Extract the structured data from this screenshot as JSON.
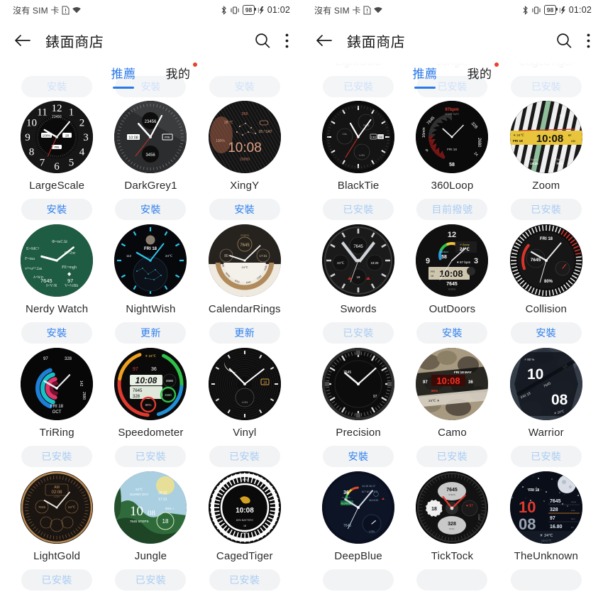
{
  "statusbar": {
    "carrier": "沒有 SIM 卡",
    "sim_icon": "sim-missing-icon",
    "wifi_icon": "wifi-icon",
    "bluetooth_icon": "bluetooth-icon",
    "vibrate_icon": "vibrate-icon",
    "battery_level": "98",
    "charging_icon": "charging-bolt-icon",
    "time": "01:02"
  },
  "appbar": {
    "back_icon": "back-arrow-icon",
    "title": "錶面商店",
    "search_icon": "search-icon",
    "more_icon": "more-vertical-icon"
  },
  "tabs": {
    "recommend": "推薦",
    "mine": "我的"
  },
  "labels": {
    "install": "安裝",
    "update": "更新",
    "installed": "已安裝",
    "current": "目前撥號"
  },
  "left_panel": {
    "ghost_row": [
      {
        "name": "",
        "action": "安裝",
        "state": "install"
      },
      {
        "name": "",
        "action": "安裝",
        "state": "install"
      },
      {
        "name": "",
        "action": "安裝",
        "state": "install"
      }
    ],
    "rows": [
      [
        {
          "name": "LargeScale",
          "action": "安裝",
          "state": "install",
          "face": "largescale"
        },
        {
          "name": "DarkGrey1",
          "action": "安裝",
          "state": "install",
          "face": "darkgrey1"
        },
        {
          "name": "XingY",
          "action": "安裝",
          "state": "install",
          "face": "xingy"
        }
      ],
      [
        {
          "name": "Nerdy Watch",
          "action": "安裝",
          "state": "install",
          "face": "nerdy"
        },
        {
          "name": "NightWish",
          "action": "更新",
          "state": "update",
          "face": "nightwish"
        },
        {
          "name": "CalendarRings",
          "action": "更新",
          "state": "update",
          "face": "calendarrings"
        }
      ],
      [
        {
          "name": "TriRing",
          "action": "已安裝",
          "state": "installed",
          "face": "triring"
        },
        {
          "name": "Speedometer",
          "action": "已安裝",
          "state": "installed",
          "face": "speedometer"
        },
        {
          "name": "Vinyl",
          "action": "已安裝",
          "state": "installed",
          "face": "vinyl"
        }
      ],
      [
        {
          "name": "LightGold",
          "action": "已安裝",
          "state": "installed",
          "face": "lightgold"
        },
        {
          "name": "Jungle",
          "action": "已安裝",
          "state": "installed",
          "face": "jungle"
        },
        {
          "name": "CagedTiger",
          "action": "已安裝",
          "state": "installed",
          "face": "cagedtiger"
        }
      ]
    ]
  },
  "right_panel": {
    "ghost_row": [
      {
        "name": "LightGold",
        "action": "已安裝",
        "state": "installed"
      },
      {
        "name": "Jungle",
        "action": "已安裝",
        "state": "installed"
      },
      {
        "name": "CagedTiger",
        "action": "已安裝",
        "state": "installed"
      }
    ],
    "rows": [
      [
        {
          "name": "BlackTie",
          "action": "已安裝",
          "state": "installed",
          "face": "blacktie"
        },
        {
          "name": "360Loop",
          "action": "目前撥號",
          "state": "current",
          "face": "loop360"
        },
        {
          "name": "Zoom",
          "action": "已安裝",
          "state": "installed",
          "face": "zoom"
        }
      ],
      [
        {
          "name": "Swords",
          "action": "已安裝",
          "state": "installed",
          "face": "swords"
        },
        {
          "name": "OutDoors",
          "action": "安裝",
          "state": "install",
          "face": "outdoors"
        },
        {
          "name": "Collision",
          "action": "安裝",
          "state": "install",
          "face": "collision"
        }
      ],
      [
        {
          "name": "Precision",
          "action": "安裝",
          "state": "install",
          "face": "precision"
        },
        {
          "name": "Camo",
          "action": "已安裝",
          "state": "installed",
          "face": "camo"
        },
        {
          "name": "Warrior",
          "action": "已安裝",
          "state": "installed",
          "face": "warrior"
        }
      ],
      [
        {
          "name": "DeepBlue",
          "action": "",
          "state": "installed",
          "face": "deepblue"
        },
        {
          "name": "TickTock",
          "action": "",
          "state": "installed",
          "face": "ticktock"
        },
        {
          "name": "TheUnknown",
          "action": "",
          "state": "installed",
          "face": "theunknown"
        }
      ]
    ]
  },
  "colors": {
    "accent": "#2979e8",
    "install_text": "#2f80ed",
    "disabled_text": "#a9cdf2",
    "button_bg": "#f2f3f5",
    "badge": "#e8402a"
  },
  "watch_face_text": {
    "largescale": {
      "steps": "23456",
      "battery": "100%",
      "date": "28",
      "day": "FRI",
      "numerals": "12 1 2 3 4 5 6 7 8 9 10 11"
    },
    "darkgrey1": {
      "steps": "23456",
      "calories": "3456",
      "time_small": "10:08",
      "day": "FRI"
    },
    "xingy": {
      "time": "10:08",
      "temp": "28 ℃",
      "battery": "100%",
      "date": "28 / SAT",
      "steps": "355",
      "bottom": "29999"
    },
    "nerdy": {
      "steps": "7645",
      "hr": "97",
      "formula1": "E=MC²",
      "formula2": "F=ma"
    },
    "nightwish": {
      "day": "FRI 18",
      "temp": "24℃",
      "alt": "112"
    },
    "calendarrings": {
      "steps": "7645",
      "goal": "80",
      "target": "17:31",
      "temp": "24℃",
      "label": "STEPS"
    },
    "triring": {
      "day": "FRI 18",
      "month": "OCT",
      "v1": "97",
      "v2": "328",
      "v3": "142",
      "v4": "2680"
    },
    "speedometer": {
      "time": "10:08",
      "ampm": "PM",
      "hr": "97",
      "stress": "36",
      "steps": "7645",
      "kcal": "328",
      "temp": "24℃",
      "dist": "2680"
    },
    "vinyl": {
      "date": "18",
      "sub": "LON"
    },
    "lightgold": {
      "ampm": "AM",
      "time": "02:08",
      "city": "LON",
      "steps": "7645",
      "temp": "24℃"
    },
    "jungle": {
      "hour": "10",
      "min": "08",
      "steps": "7645 STEPS",
      "temp": "24℃",
      "cond": "SUNNY DAY",
      "sunset": "20:22",
      "sunrise": "17:31",
      "battery": "80%",
      "date": "18"
    },
    "cagedtiger": {
      "time": "10:08",
      "sign": "LIBRA",
      "battery": "80% BATTERY",
      "temp": "24℃",
      "cond": "SUNNY DAY",
      "date": "18"
    },
    "blacktie": {
      "steps": "7645",
      "day": "FRI",
      "date": "18",
      "city": "LON"
    },
    "loop360": {
      "hr": "97bpm",
      "steps": "7645",
      "kcal": "328",
      "dist": "2680",
      "sleep": "16min",
      "hours": "9",
      "day": "FRI 18",
      "bottom": "58",
      "right": "24"
    },
    "zoom": {
      "time": "10:08",
      "ampm": "AM",
      "temp": "24℃",
      "day": "FRI",
      "date": "18",
      "hr": "97",
      "sunset": "19:20",
      "steps": "7645"
    },
    "swords": {
      "steps": "7645",
      "temp": "24℃",
      "time2": "18:20",
      "date": "18"
    },
    "outdoors": {
      "time": "10:08",
      "steps": "7645",
      "hr": "97",
      "temp": "24℃",
      "vo2": "58",
      "day": "FRI",
      "date": "18",
      "label": "STEPS"
    },
    "collision": {
      "day": "FRI 18",
      "steps": "7645",
      "battery": "80%"
    },
    "precision": {
      "steps": "7645",
      "hr": "97"
    },
    "camo": {
      "time": "10:08",
      "date": "FRI 18 MAY",
      "hr": "97",
      "sec": "36",
      "battery": "80%",
      "temp": "24℃",
      "range": "18/32℃"
    },
    "warrior": {
      "hour": "10",
      "min": "08",
      "battery": "80 %",
      "steps": "7645",
      "hr": "94",
      "day": "FRI 18",
      "temp": "24℃"
    },
    "deepblue": {
      "stress": "36",
      "label": "STRESS",
      "status": "NORMAL",
      "steps": "7645",
      "city": "LON"
    },
    "ticktock": {
      "steps": "7645",
      "kcal": "328",
      "hr": "97",
      "date": "18",
      "dist": "2680"
    },
    "theunknown": {
      "day": "FRI 18",
      "hour": "10",
      "min": "08",
      "steps": "7645",
      "kcal": "328",
      "hr": "97",
      "dist": "16.80",
      "temp": "24℃",
      "range": "18/32℃"
    }
  }
}
